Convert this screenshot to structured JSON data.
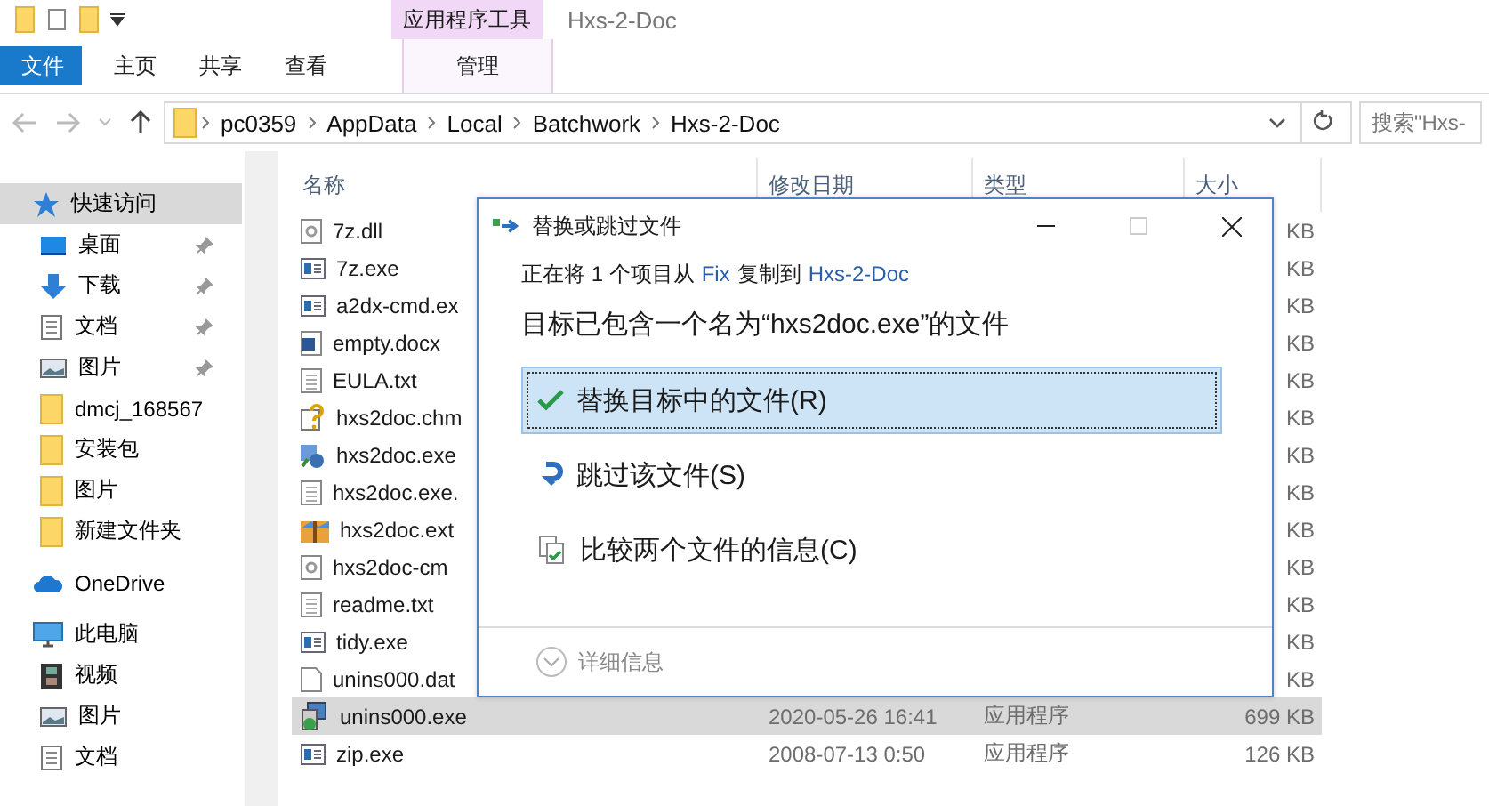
{
  "titlebar": {
    "context_group": "应用程序工具",
    "title": "Hxs-2-Doc"
  },
  "ribbon_tabs": [
    {
      "label": "文件",
      "kind": "file",
      "selected": false
    },
    {
      "label": "主页",
      "kind": "tab",
      "selected": false
    },
    {
      "label": "共享",
      "kind": "tab",
      "selected": false
    },
    {
      "label": "查看",
      "kind": "tab",
      "selected": false
    },
    {
      "label": "管理",
      "kind": "context",
      "selected": false
    }
  ],
  "address_bar": {
    "path": [
      "pc0359",
      "AppData",
      "Local",
      "Batchwork",
      "Hxs-2-Doc"
    ],
    "search_placeholder": "搜索\"Hxs-"
  },
  "nav_pane": [
    {
      "label": "快速访问",
      "kind": "quick",
      "selected": true,
      "children": [
        {
          "label": "桌面",
          "kind": "desktop",
          "pinned": true,
          "selected": false
        },
        {
          "label": "下载",
          "kind": "download",
          "pinned": true,
          "selected": false
        },
        {
          "label": "文档",
          "kind": "docs",
          "pinned": true,
          "selected": false
        },
        {
          "label": "图片",
          "kind": "pics",
          "pinned": true,
          "selected": false
        },
        {
          "label": "dmcj_168567",
          "kind": "folder",
          "pinned": false,
          "selected": false
        },
        {
          "label": "安装包",
          "kind": "folder",
          "pinned": false,
          "selected": false
        },
        {
          "label": "图片",
          "kind": "folder",
          "pinned": false,
          "selected": false
        },
        {
          "label": "新建文件夹",
          "kind": "folder",
          "pinned": false,
          "selected": false
        }
      ]
    },
    {
      "label": "OneDrive",
      "kind": "cloud",
      "selected": false
    },
    {
      "label": "此电脑",
      "kind": "pc",
      "selected": false,
      "children": [
        {
          "label": "视频",
          "kind": "video",
          "pinned": false,
          "selected": false
        },
        {
          "label": "图片",
          "kind": "pics",
          "pinned": false,
          "selected": false
        },
        {
          "label": "文档",
          "kind": "docs",
          "pinned": false,
          "selected": false
        }
      ]
    }
  ],
  "file_list": {
    "columns": [
      "名称",
      "修改日期",
      "类型",
      "大小"
    ],
    "rows": [
      {
        "name": "7z.dll",
        "kind": "dll",
        "size": "KB",
        "selected": false
      },
      {
        "name": "7z.exe",
        "kind": "exe",
        "size": "KB",
        "selected": false
      },
      {
        "name": "a2dx-cmd.ex",
        "kind": "exe",
        "size": "KB",
        "selected": false
      },
      {
        "name": "empty.docx",
        "kind": "docx",
        "size": "KB",
        "selected": false
      },
      {
        "name": "EULA.txt",
        "kind": "txt",
        "size": "KB",
        "selected": false
      },
      {
        "name": "hxs2doc.chm",
        "kind": "chm",
        "size": "KB",
        "selected": false
      },
      {
        "name": "hxs2doc.exe",
        "kind": "app",
        "size": "KB",
        "selected": false
      },
      {
        "name": "hxs2doc.exe.",
        "kind": "txt",
        "size": "KB",
        "selected": false
      },
      {
        "name": "hxs2doc.ext",
        "kind": "archive",
        "size": "KB",
        "selected": false
      },
      {
        "name": "hxs2doc-cm",
        "kind": "dll",
        "size": "KB",
        "selected": false
      },
      {
        "name": "readme.txt",
        "kind": "txt",
        "size": "KB",
        "selected": false
      },
      {
        "name": "tidy.exe",
        "kind": "exe",
        "size": "KB",
        "selected": false
      },
      {
        "name": "unins000.dat",
        "kind": "blank",
        "size": "KB",
        "selected": false
      },
      {
        "name": "unins000.exe",
        "kind": "setup",
        "date": "2020-05-26 16:41",
        "type": "应用程序",
        "size": "699 KB",
        "selected": true
      },
      {
        "name": "zip.exe",
        "kind": "exe",
        "date": "2008-07-13 0:50",
        "type": "应用程序",
        "size": "126 KB",
        "selected": false
      }
    ]
  },
  "dialog": {
    "title": "替换或跳过文件",
    "maximize_disabled": true,
    "status": {
      "prefix": "正在将 1 个项目从",
      "source": "Fix",
      "middle": "复制到",
      "destination": "Hxs-2-Doc"
    },
    "heading": "目标已包含一个名为“hxs2doc.exe”的文件",
    "options": [
      {
        "label": "替换目标中的文件(R)",
        "kind": "replace",
        "selected": true
      },
      {
        "label": "跳过该文件(S)",
        "kind": "skip",
        "selected": false
      },
      {
        "label": "比较两个文件的信息(C)",
        "kind": "compare",
        "selected": false
      }
    ],
    "details_label": "详细信息"
  }
}
